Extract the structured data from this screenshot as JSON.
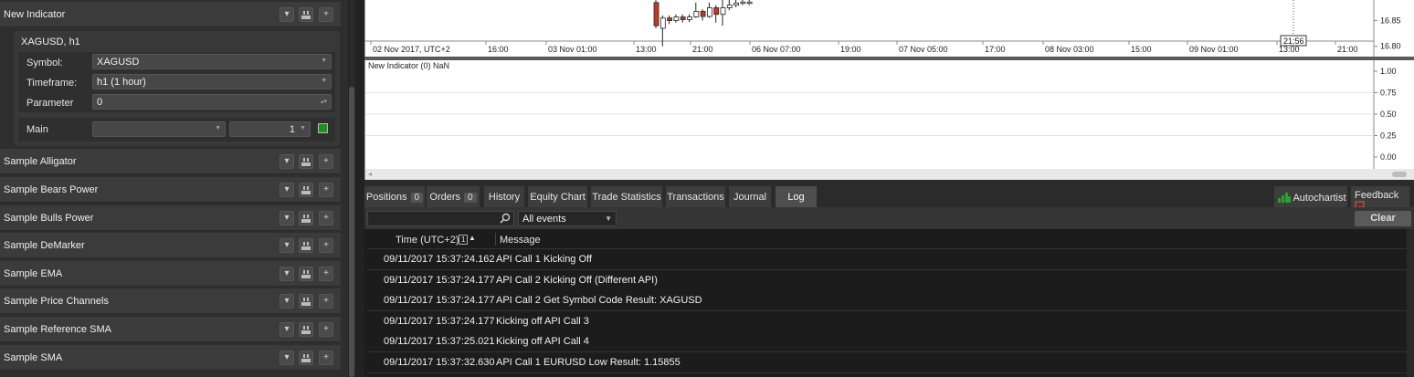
{
  "left_panel": {
    "new_indicator": {
      "label": "New Indicator"
    },
    "instance": {
      "title": "XAGUSD, h1",
      "params": [
        {
          "label": "Symbol:",
          "value": "XAGUSD"
        },
        {
          "label": "Timeframe:",
          "value": "h1 (1 hour)"
        },
        {
          "label": "Parameter",
          "value": "0"
        }
      ],
      "main": {
        "label": "Main",
        "thickness": "1",
        "color": "#1f8f1f"
      }
    },
    "indicators": [
      {
        "label": "Sample Alligator"
      },
      {
        "label": "Sample Bears Power"
      },
      {
        "label": "Sample Bulls Power"
      },
      {
        "label": "Sample DeMarker"
      },
      {
        "label": "Sample EMA"
      },
      {
        "label": "Sample Price Channels"
      },
      {
        "label": "Sample Reference SMA"
      },
      {
        "label": "Sample SMA"
      }
    ],
    "button_icons": [
      "chevron-down-icon",
      "copy-icon",
      "add-icon"
    ]
  },
  "chart": {
    "price_ticks": [
      "16.85",
      "16.80"
    ],
    "time_labels": [
      "02 Nov 2017, UTC+2",
      "16:00",
      "03 Nov 01:00",
      "13:00",
      "21:00",
      "06 Nov 07:00",
      "19:00",
      "07 Nov 05:00",
      "17:00",
      "08 Nov 03:00",
      "15:00",
      "09 Nov 01:00",
      "13:00",
      "21:00"
    ],
    "crosshair_time": "21:56",
    "candles": [
      {
        "open": 16.885,
        "close": 16.84,
        "high": 16.89,
        "low": 16.835,
        "color": "red"
      },
      {
        "open": 16.835,
        "close": 16.855,
        "high": 16.86,
        "low": 16.8,
        "color": "white"
      },
      {
        "open": 16.855,
        "close": 16.85,
        "high": 16.86,
        "low": 16.843,
        "color": "red"
      },
      {
        "open": 16.85,
        "close": 16.857,
        "high": 16.862,
        "low": 16.846,
        "color": "white"
      },
      {
        "open": 16.857,
        "close": 16.852,
        "high": 16.862,
        "low": 16.846,
        "color": "red"
      },
      {
        "open": 16.852,
        "close": 16.857,
        "high": 16.862,
        "low": 16.847,
        "color": "white"
      },
      {
        "open": 16.857,
        "close": 16.868,
        "high": 16.885,
        "low": 16.855,
        "color": "white"
      },
      {
        "open": 16.868,
        "close": 16.858,
        "high": 16.872,
        "low": 16.85,
        "color": "red"
      },
      {
        "open": 16.858,
        "close": 16.875,
        "high": 16.885,
        "low": 16.855,
        "color": "white"
      },
      {
        "open": 16.875,
        "close": 16.862,
        "high": 16.88,
        "low": 16.846,
        "color": "red"
      },
      {
        "open": 16.862,
        "close": 16.875,
        "high": 16.89,
        "low": 16.84,
        "color": "white"
      },
      {
        "open": 16.875,
        "close": 16.88,
        "high": 16.89,
        "low": 16.87,
        "color": "white"
      },
      {
        "open": 16.88,
        "close": 16.884,
        "high": 16.89,
        "low": 16.876,
        "color": "white"
      },
      {
        "open": 16.884,
        "close": 16.886,
        "high": 16.89,
        "low": 16.88,
        "color": "white"
      },
      {
        "open": 16.886,
        "close": 16.884,
        "high": 16.89,
        "low": 16.88,
        "color": "white"
      }
    ]
  },
  "indicator_pane": {
    "title": "New Indicator (0) NaN",
    "ticks": [
      "1.00",
      "0.75",
      "0.50",
      "0.25",
      "0.00"
    ]
  },
  "tabs": [
    {
      "label": "Positions",
      "badge": "0"
    },
    {
      "label": "Orders",
      "badge": "0"
    },
    {
      "label": "History"
    },
    {
      "label": "Equity Chart"
    },
    {
      "label": "Trade Statistics"
    },
    {
      "label": "Transactions"
    },
    {
      "label": "Journal"
    },
    {
      "label": "Log",
      "active": true
    }
  ],
  "autochartist": {
    "label": "Autochartist"
  },
  "feedback": {
    "label": "Feedback"
  },
  "filter": {
    "search_value": "",
    "events": "All events",
    "clear": "Clear"
  },
  "log": {
    "columns": {
      "time": "Time (UTC+2)",
      "message": "Message",
      "sort_badge": "1"
    },
    "rows": [
      {
        "time": "09/11/2017 15:37:24.162",
        "message": "API Call 1 Kicking Off"
      },
      {
        "time": "09/11/2017 15:37:24.177",
        "message": "API Call 2 Kicking Off (Different API)"
      },
      {
        "time": "09/11/2017 15:37:24.177",
        "message": "API Call 2 Get Symbol Code Result: XAGUSD"
      },
      {
        "time": "09/11/2017 15:37:24.177",
        "message": "Kicking off API Call 3"
      },
      {
        "time": "09/11/2017 15:37:25.021",
        "message": "Kicking off API Call 4"
      },
      {
        "time": "09/11/2017 15:37:32.630",
        "message": "API Call 1 EURUSD Low Result: 1.15855"
      }
    ]
  }
}
